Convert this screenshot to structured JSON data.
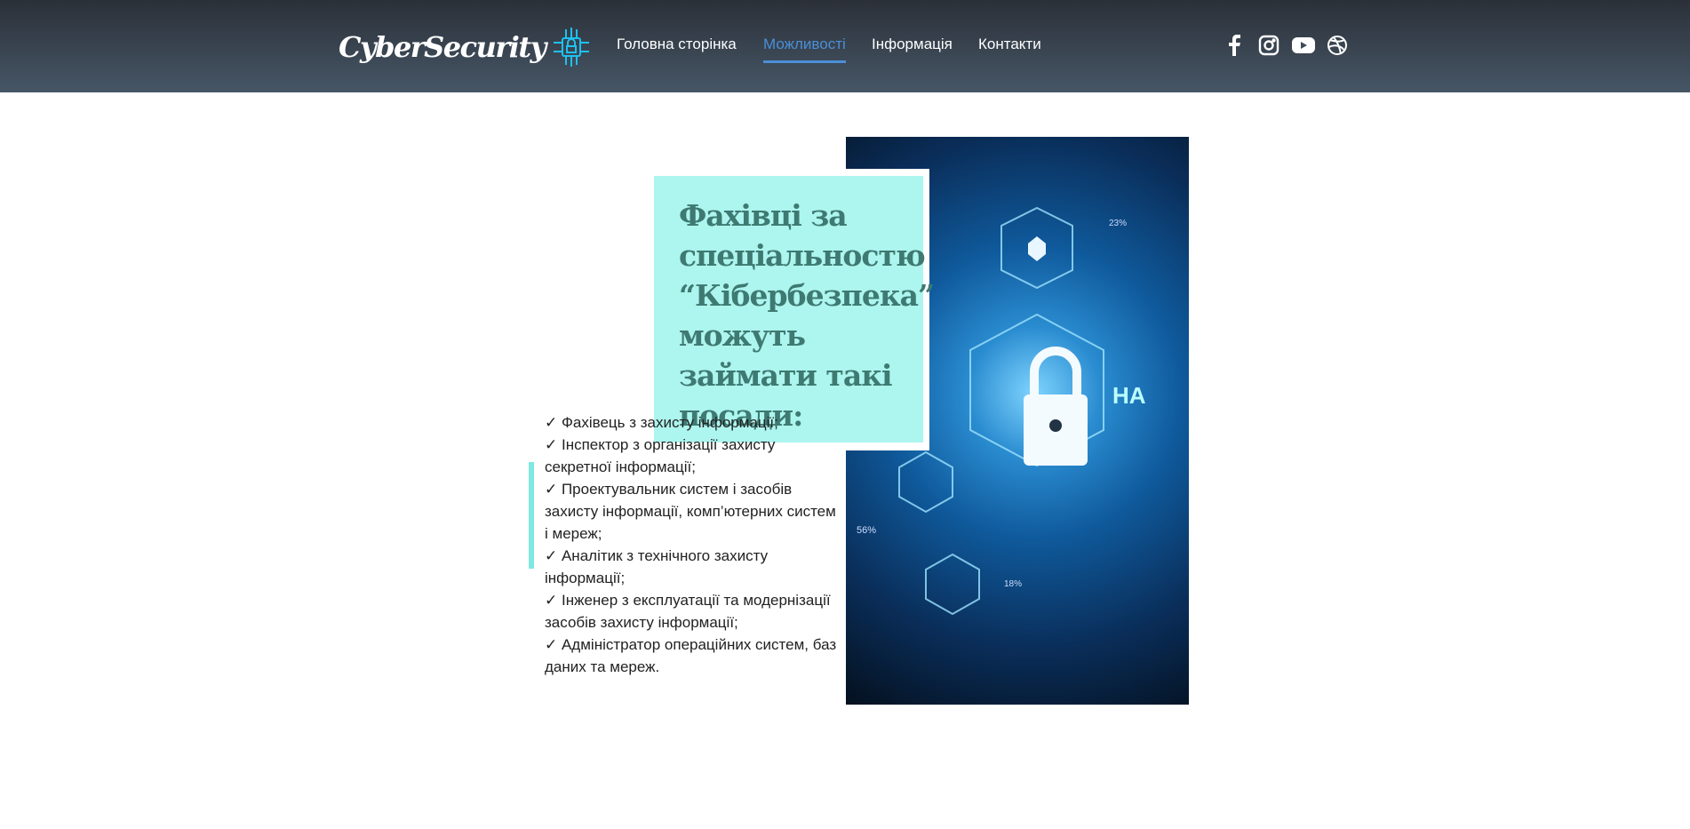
{
  "header": {
    "logo_text": "CyberSecurity",
    "nav": [
      "Головна сторінка",
      "Можливості",
      "Інформація",
      "Контакти"
    ],
    "active_nav": "Можливості",
    "accent": "#4a8fd8",
    "social": [
      "facebook-icon",
      "instagram-icon",
      "youtube-icon",
      "dribbble-icon"
    ]
  },
  "main": {
    "heading": "Фахівці за спеціальностю “Кібербезпека” можуть займати такі посади:",
    "positions": [
      "✓ Фахівець з захисту інформації;",
      "✓ Інспектор з організації захисту секретної інформації;",
      "✓ Проектувальник систем і засобів захисту інформації, комп’ютерних систем і мереж;",
      "✓ Аналітик з технічного захисту інформації;",
      "✓ Інженер з експлуатації та модернізації засобів захисту інформації;",
      "✓ Адміністратор операційних систем, баз даних та мереж."
    ],
    "image_labels": [
      "23%",
      "56%",
      "18%",
      "HA"
    ]
  }
}
